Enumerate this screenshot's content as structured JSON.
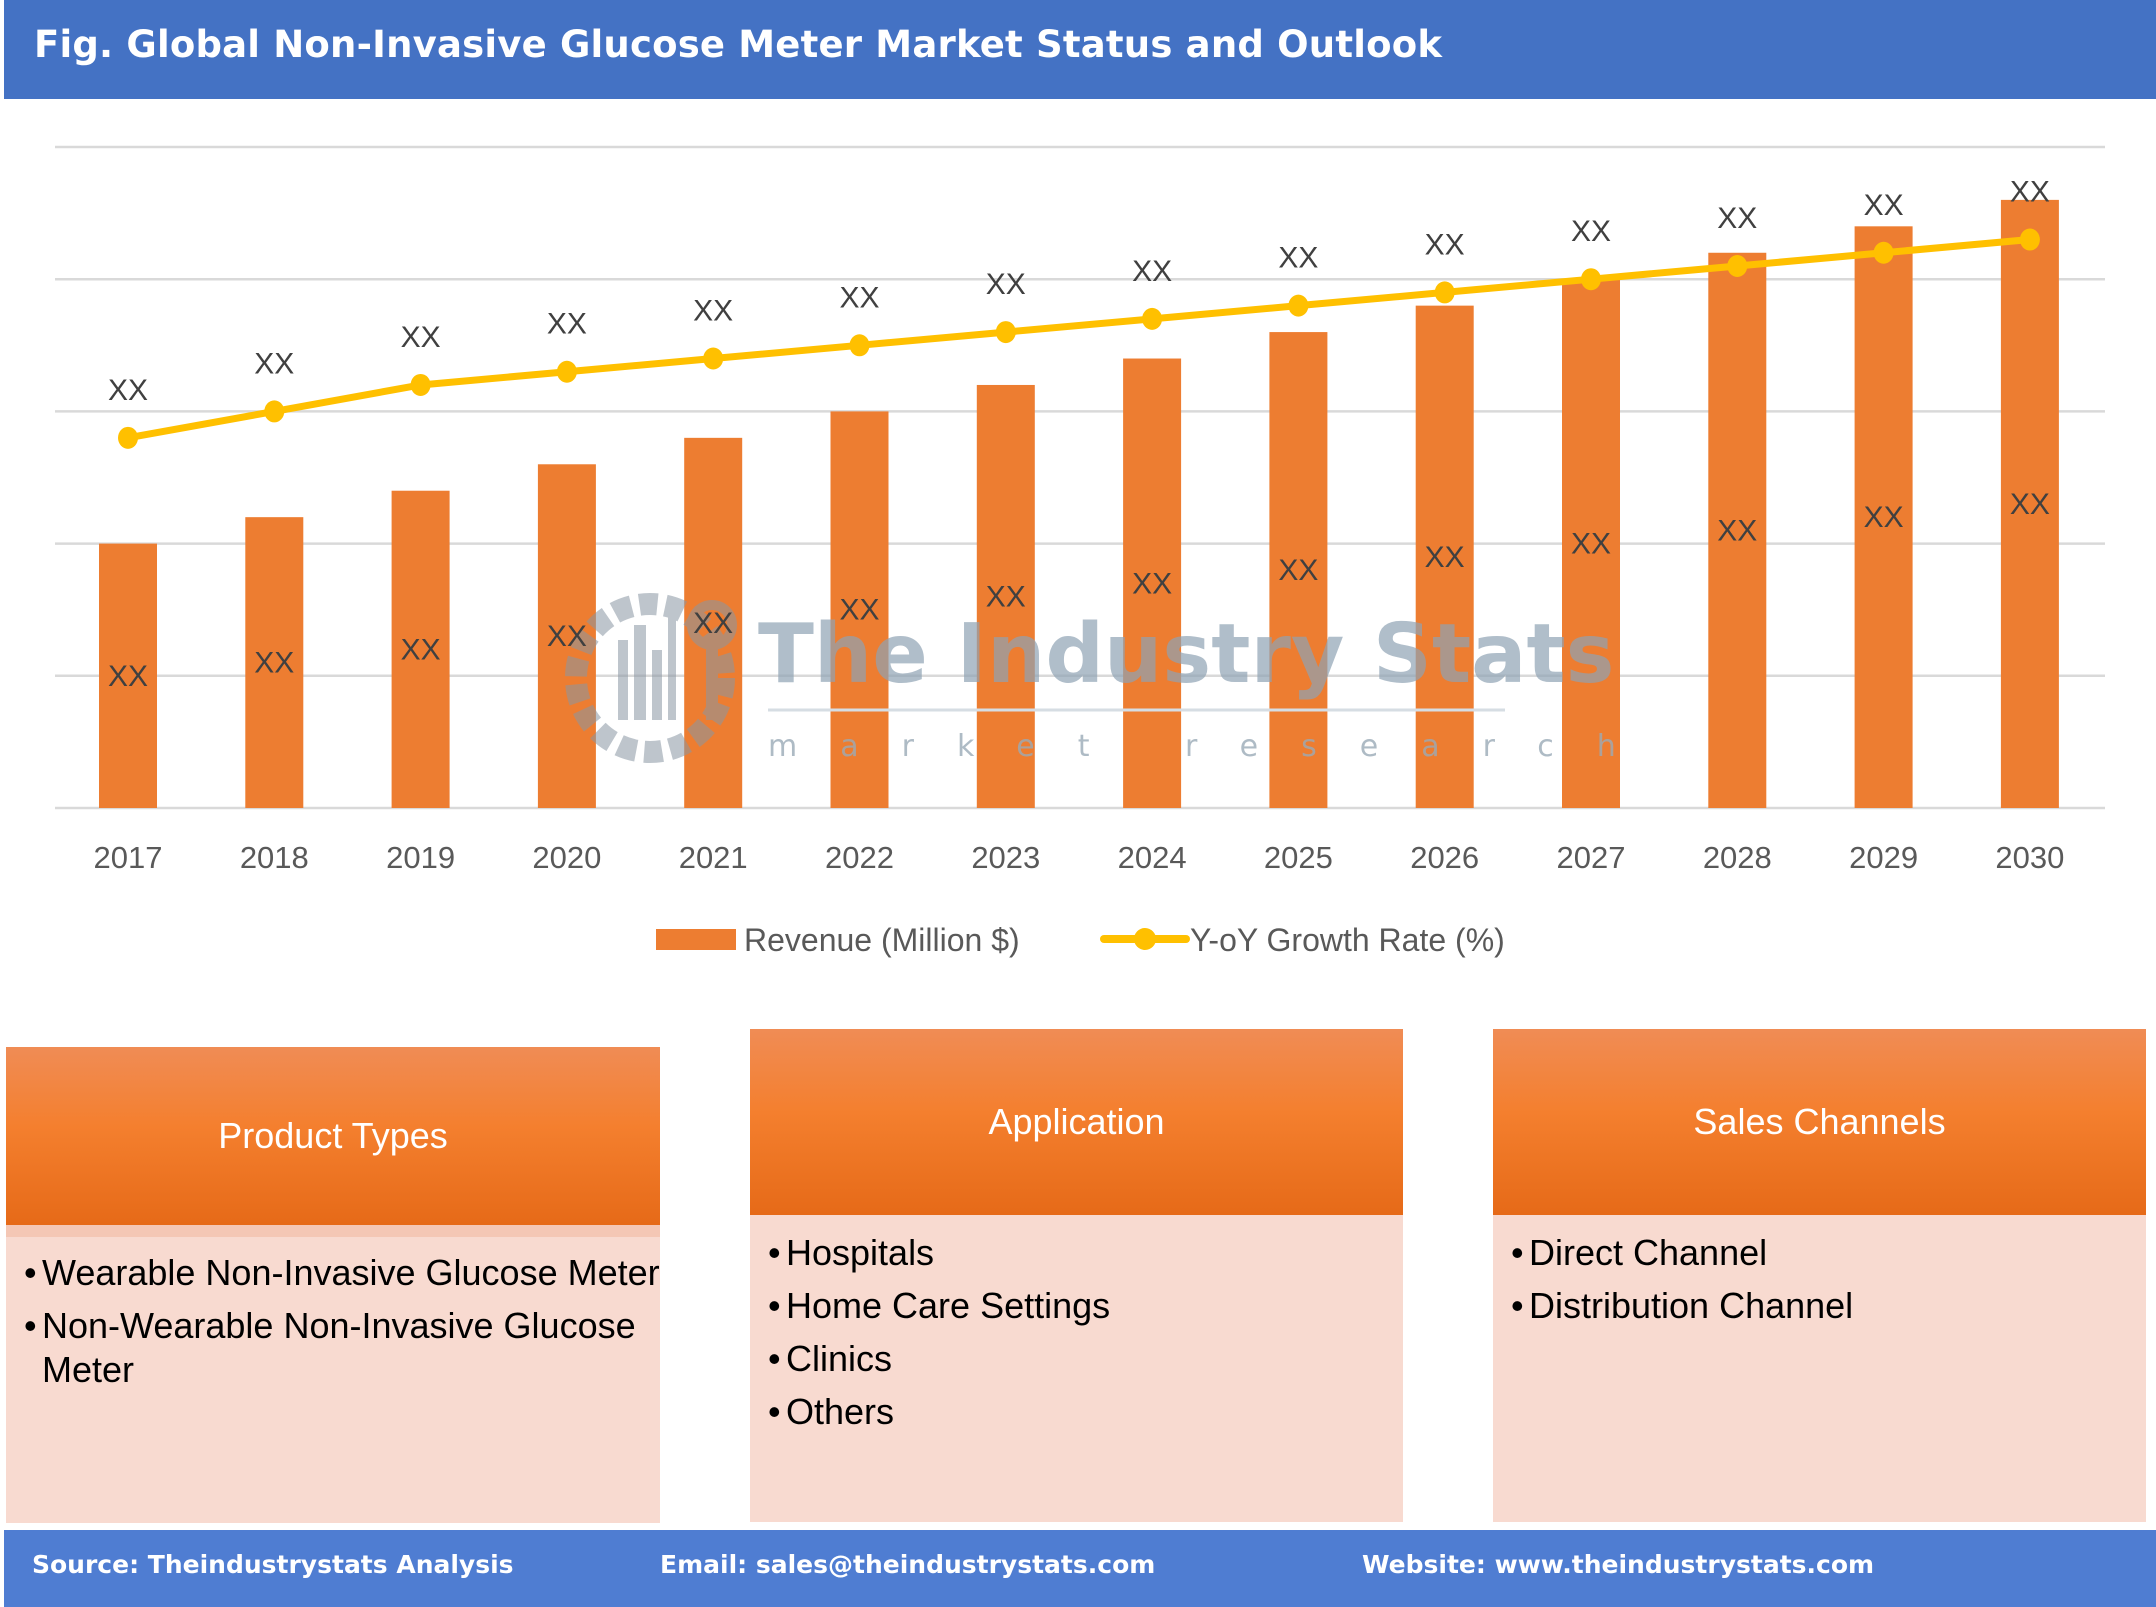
{
  "header": {
    "title": "Fig. Global Non-Invasive Glucose Meter Market Status and Outlook"
  },
  "chart_data": {
    "type": "bar+line",
    "title": "Fig. Global Non-Invasive Glucose Meter Market Status and Outlook",
    "xlabel": "",
    "ylabel": "",
    "categories": [
      "2017",
      "2018",
      "2019",
      "2020",
      "2021",
      "2022",
      "2023",
      "2024",
      "2025",
      "2026",
      "2027",
      "2028",
      "2029",
      "2030"
    ],
    "series": [
      {
        "name": "Revenue (Million $)",
        "type": "bar",
        "color": "#ED7D31",
        "values": [
          2.0,
          2.2,
          2.4,
          2.6,
          2.8,
          3.0,
          3.2,
          3.4,
          3.6,
          3.8,
          4.0,
          4.2,
          4.4,
          4.6
        ],
        "data_labels": [
          "XX",
          "XX",
          "XX",
          "XX",
          "XX",
          "XX",
          "XX",
          "XX",
          "XX",
          "XX",
          "XX",
          "XX",
          "XX",
          "XX"
        ]
      },
      {
        "name": "Y-oY Growth Rate (%)",
        "type": "line",
        "color": "#FFC000",
        "values": [
          2.8,
          3.0,
          3.2,
          3.3,
          3.4,
          3.5,
          3.6,
          3.7,
          3.8,
          3.9,
          4.0,
          4.1,
          4.2,
          4.3
        ],
        "data_labels": [
          "XX",
          "XX",
          "XX",
          "XX",
          "XX",
          "XX",
          "XX",
          "XX",
          "XX",
          "XX",
          "XX",
          "XX",
          "XX",
          "XX"
        ]
      }
    ],
    "ylim": [
      0,
      5
    ],
    "value_note": "Actual values hidden (shown as XX); values are relative positions in gridline units",
    "grid": true,
    "legend_position": "bottom",
    "watermark": {
      "title": "The Industry Stats",
      "subtitle": "market research"
    }
  },
  "segments": [
    {
      "title": "Product Types",
      "items": [
        "Wearable Non-Invasive Glucose Meter",
        "Non-Wearable Non-Invasive Glucose Meter"
      ]
    },
    {
      "title": "Application",
      "items": [
        "Hospitals",
        "Home Care Settings",
        "Clinics",
        "Others"
      ]
    },
    {
      "title": "Sales Channels",
      "items": [
        "Direct Channel",
        "Distribution Channel"
      ]
    }
  ],
  "bullet": "•",
  "footer": {
    "source": "Source: Theindustrystats Analysis",
    "email": "Email: sales@theindustrystats.com",
    "website": "Website: www.theindustrystats.com"
  }
}
